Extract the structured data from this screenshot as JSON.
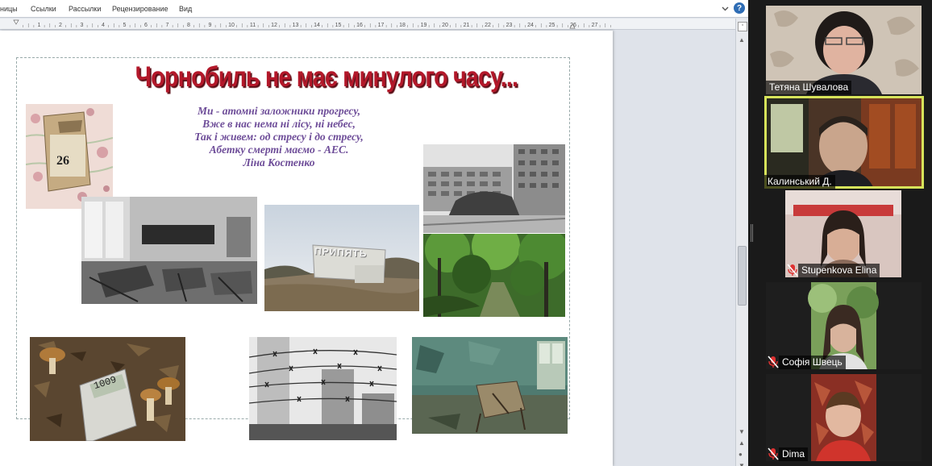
{
  "word": {
    "ribbon_tabs": [
      "ницы",
      "Ссылки",
      "Рассылки",
      "Рецензирование",
      "Вид"
    ],
    "ruler_labels": [
      "1",
      "2",
      "3",
      "4",
      "5",
      "6",
      "7",
      "8",
      "9",
      "10",
      "11",
      "12",
      "13",
      "14",
      "15",
      "16",
      "17",
      "18",
      "19",
      "20",
      "21",
      "22",
      "23",
      "24",
      "25",
      "26",
      "27"
    ],
    "icons": {
      "minimize_ribbon": "chevron-down-icon",
      "help": "help-icon"
    },
    "help_glyph": "?",
    "vertical_scroll_position": 0.62
  },
  "slide": {
    "title": "Чорнобиль не має минулого часу...",
    "title_color": "#b3182a",
    "poem_color": "#6d4c98",
    "poem": [
      "Ми - атомні заложники прогресу,",
      "Вже в нас нема ні лісу, ні небес,",
      "Так і живем: од стресу і до стресу,",
      "Абетку смерті маємо - АЕС.",
      "Ліна Костенко"
    ],
    "photos": {
      "calendar_day": "26",
      "pripyat_sign": "ПРИПЯТЬ",
      "dosimeter_reading": "1009"
    }
  },
  "participants": [
    {
      "name": "Тетяна Шувалова",
      "muted": false,
      "active": false
    },
    {
      "name": "Калинський Д.",
      "muted": false,
      "active": true
    },
    {
      "name": "Stupenkova Elina",
      "muted": true,
      "active": false
    },
    {
      "name": "Софія Швець",
      "muted": true,
      "active": false
    },
    {
      "name": "Dima",
      "muted": true,
      "active": false
    }
  ],
  "colors": {
    "active_speaker": "#d7e35a",
    "mute_icon": "#e03131"
  }
}
